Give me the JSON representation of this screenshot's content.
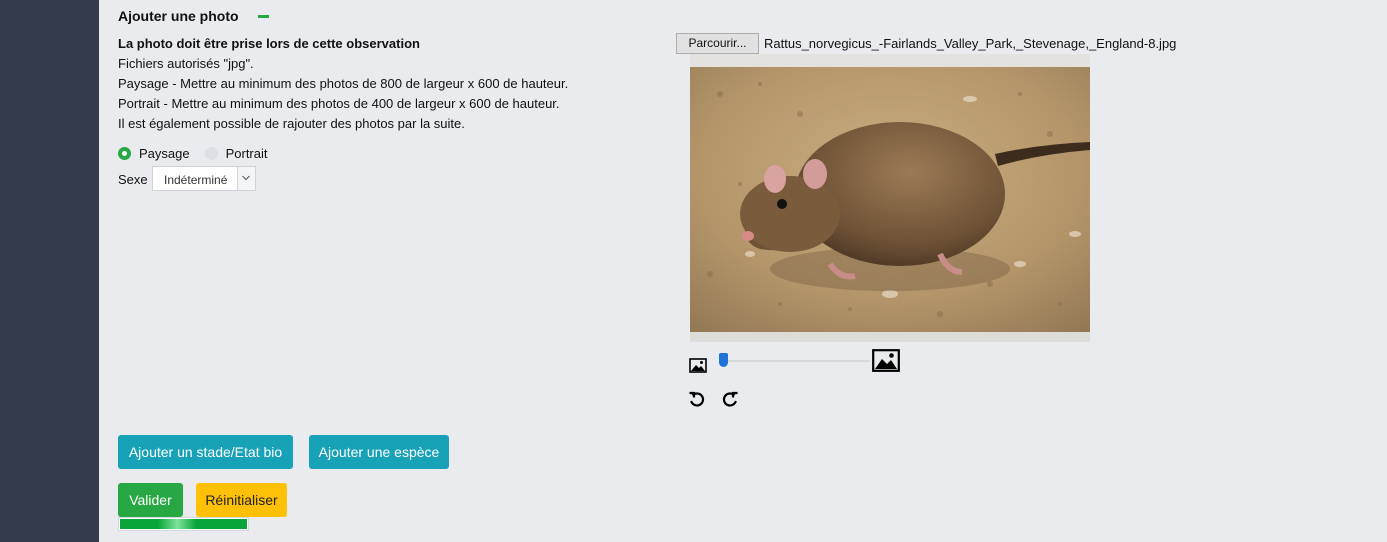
{
  "section": {
    "title": "Ajouter une photo"
  },
  "description": {
    "heading": "La photo doit être prise lors de cette observation",
    "lines": [
      "Fichiers autorisés \"jpg\".",
      "Paysage - Mettre au minimum des photos de 800 de largeur x 600 de hauteur.",
      "Portrait - Mettre au minimum des photos de 400 de largeur x 600 de hauteur.",
      "Il est également possible de rajouter des photos par la suite."
    ]
  },
  "orientation": {
    "options": [
      {
        "label": "Paysage",
        "checked": true
      },
      {
        "label": "Portrait",
        "checked": false
      }
    ]
  },
  "sexe": {
    "label": "Sexe",
    "value": "Indéterminé"
  },
  "file": {
    "browse_label": "Parcourir...",
    "filename": "Rattus_norvegicus_-Fairlands_Valley_Park,_Stevenage,_England-8.jpg"
  },
  "zoom": {
    "value_fraction": 0.02
  },
  "buttons": {
    "add_stage": "Ajouter un stade/Etat bio",
    "add_species": "Ajouter une espèce",
    "submit": "Valider",
    "reset": "Réinitialiser"
  },
  "progress": {
    "fraction": 1.0
  },
  "colors": {
    "sidebar": "#343c4b",
    "background": "#e9ebee",
    "accent_green": "#28a745",
    "teal": "#17a2b8",
    "warning": "#ffc107",
    "slider_blue": "#1e73d8"
  },
  "icons": {
    "collapse": "minus-icon",
    "zoom_out": "image-small-icon",
    "zoom_in": "image-large-icon",
    "rotate_left": "rotate-left-icon",
    "rotate_right": "rotate-right-icon"
  }
}
